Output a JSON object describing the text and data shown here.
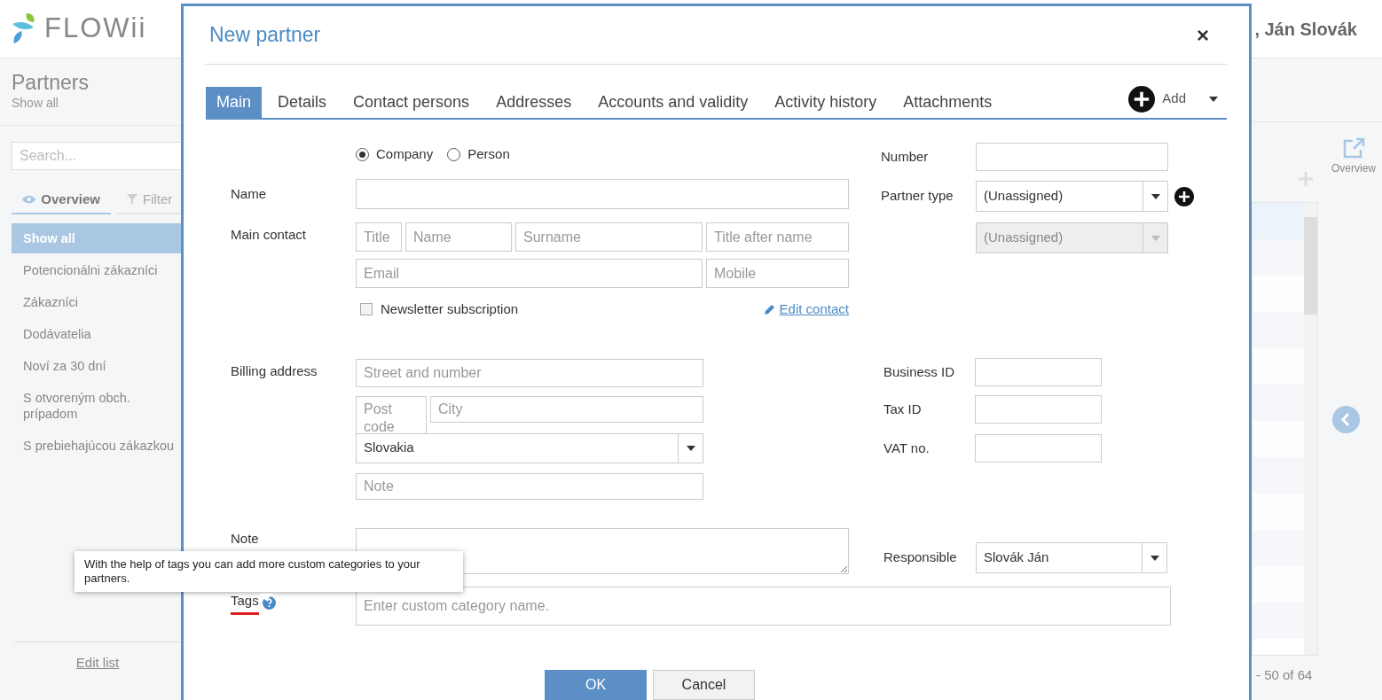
{
  "app": {
    "logo_text": "FLOWii",
    "user": ", Ján Slovák"
  },
  "sidebar": {
    "title": "Partners",
    "subtitle": "Show all",
    "search_placeholder": "Search...",
    "tabs": [
      {
        "label": "Overview",
        "selected": true
      },
      {
        "label": "Filter",
        "selected": false
      }
    ],
    "items": [
      {
        "label": "Show all",
        "selected": true
      },
      {
        "label": "Potencionálni zákazníci",
        "selected": false
      },
      {
        "label": "Zákazníci",
        "selected": false
      },
      {
        "label": "Dodávatelia",
        "selected": false
      },
      {
        "label": "Noví za 30 dní",
        "selected": false
      },
      {
        "label": "S otvoreným obch. prípadom",
        "selected": false
      },
      {
        "label": "S prebiehajúcou zákazkou",
        "selected": false
      }
    ],
    "footer_link": "Edit list"
  },
  "right_panel": {
    "overview_label": "Overview",
    "pager": "- 50 of 64"
  },
  "dialog": {
    "title": "New partner",
    "close": "×",
    "tabs": [
      {
        "label": "Main",
        "selected": true
      },
      {
        "label": "Details",
        "selected": false
      },
      {
        "label": "Contact persons",
        "selected": false
      },
      {
        "label": "Addresses",
        "selected": false
      },
      {
        "label": "Accounts and validity",
        "selected": false
      },
      {
        "label": "Activity history",
        "selected": false
      },
      {
        "label": "Attachments",
        "selected": false
      }
    ],
    "add_label": "Add",
    "partner_kind": [
      {
        "label": "Company",
        "selected": true
      },
      {
        "label": "Person",
        "selected": false
      }
    ],
    "name_label": "Name",
    "main_contact_label": "Main contact",
    "contact_fields": {
      "title": {
        "placeholder": "Title"
      },
      "name": {
        "placeholder": "Name"
      },
      "surname": {
        "placeholder": "Surname"
      },
      "title_after": {
        "placeholder": "Title after name"
      },
      "email": {
        "placeholder": "Email"
      },
      "mobile": {
        "placeholder": "Mobile"
      }
    },
    "newsletter": {
      "label": "Newsletter subscription",
      "checked": false
    },
    "edit_contact": "Edit contact",
    "billing_label": "Billing address",
    "address_fields": {
      "street": {
        "placeholder": "Street and number"
      },
      "post_code": {
        "placeholder": "Post code"
      },
      "city": {
        "placeholder": "City"
      },
      "note": {
        "placeholder": "Note"
      }
    },
    "country": "Slovakia",
    "note_label": "Note",
    "tags_label": "Tags",
    "tags_placeholder": "Enter custom category name.",
    "tooltip": "With the help of tags you can add more custom categories to your partners.",
    "number_label": "Number",
    "partner_type_label": "Partner type",
    "partner_type": "(Unassigned)",
    "partner_subtype": {
      "value": "(Unassigned)",
      "disabled": true
    },
    "business_id_label": "Business ID",
    "tax_id_label": "Tax ID",
    "vat_label": "VAT no.",
    "responsible_label": "Responsible",
    "responsible": "Slovák Ján",
    "buttons": [
      {
        "label": "OK",
        "kind": "primary"
      },
      {
        "label": "Cancel",
        "kind": "secondary"
      }
    ]
  }
}
